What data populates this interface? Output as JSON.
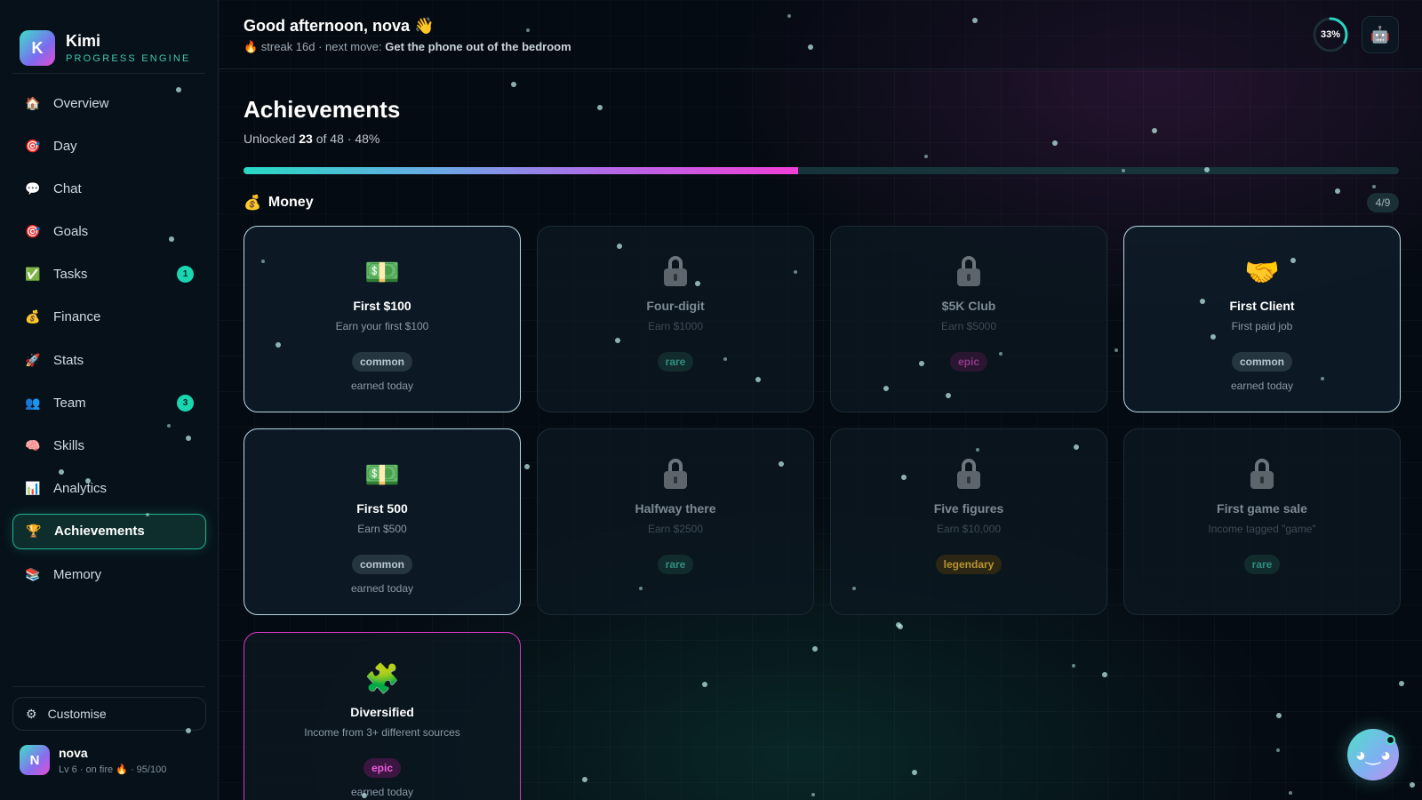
{
  "brand": {
    "name": "Kimi",
    "subtitle": "PROGRESS ENGINE",
    "logo_letter": "K"
  },
  "sidebar": {
    "items": [
      {
        "label": "Overview",
        "icon": "🏠"
      },
      {
        "label": "Day",
        "icon": "🎯"
      },
      {
        "label": "Chat",
        "icon": "💬"
      },
      {
        "label": "Goals",
        "icon": "🎯"
      },
      {
        "label": "Tasks",
        "icon": "✅",
        "badge": "1"
      },
      {
        "label": "Finance",
        "icon": "💰"
      },
      {
        "label": "Stats",
        "icon": "🚀"
      },
      {
        "label": "Team",
        "icon": "👥",
        "badge": "3"
      },
      {
        "label": "Skills",
        "icon": "🧠"
      },
      {
        "label": "Analytics",
        "icon": "📊"
      },
      {
        "label": "Achievements",
        "icon": "🏆",
        "active": true
      },
      {
        "label": "Memory",
        "icon": "📚"
      }
    ],
    "customise": {
      "label": "Customise",
      "icon": "⚙"
    },
    "user": {
      "initial": "N",
      "name": "nova",
      "meta": "Lv 6 · on fire 🔥 · 95/100"
    }
  },
  "header": {
    "greeting": "Good afternoon, nova 👋",
    "streak_prefix": "🔥 streak 16d · next move: ",
    "next_move": "Get the phone out of the bedroom",
    "progress_ring_label": "33%",
    "progress_ring_value": 0.33,
    "bot_icon": "🤖"
  },
  "page": {
    "title": "Achievements",
    "unlocked_prefix": "Unlocked ",
    "unlocked_count": "23",
    "unlocked_suffix": " of 48 · 48%",
    "progress_fraction": 0.48
  },
  "section": {
    "icon": "💰",
    "title": "Money",
    "count": "4/9"
  },
  "achievements": [
    {
      "title": "First $100",
      "desc": "Earn your first $100",
      "rarity": "common",
      "earned": "earned today",
      "icon": "💵",
      "unlocked": true
    },
    {
      "title": "Four-digit",
      "desc": "Earn $1000",
      "rarity": "rare",
      "unlocked": false
    },
    {
      "title": "$5K Club",
      "desc": "Earn $5000",
      "rarity": "epic",
      "unlocked": false
    },
    {
      "title": "First Client",
      "desc": "First paid job",
      "rarity": "common",
      "earned": "earned today",
      "icon": "🤝",
      "unlocked": true
    },
    {
      "title": "First 500",
      "desc": "Earn $500",
      "rarity": "common",
      "earned": "earned today",
      "icon": "💵",
      "unlocked": true
    },
    {
      "title": "Halfway there",
      "desc": "Earn $2500",
      "rarity": "rare",
      "unlocked": false
    },
    {
      "title": "Five figures",
      "desc": "Earn $10,000",
      "rarity": "legendary",
      "unlocked": false
    },
    {
      "title": "First game sale",
      "desc": "Income tagged \"game\"",
      "rarity": "rare",
      "unlocked": false
    },
    {
      "title": "Diversified",
      "desc": "Income from 3+ different sources",
      "rarity": "epic",
      "earned": "earned today",
      "icon": "🧩",
      "unlocked": true
    }
  ],
  "chat_bubble_icon": "◕‿◕",
  "colors": {
    "accent": "#19d6b0",
    "epic": "#d637c1",
    "background": "#050b12"
  }
}
